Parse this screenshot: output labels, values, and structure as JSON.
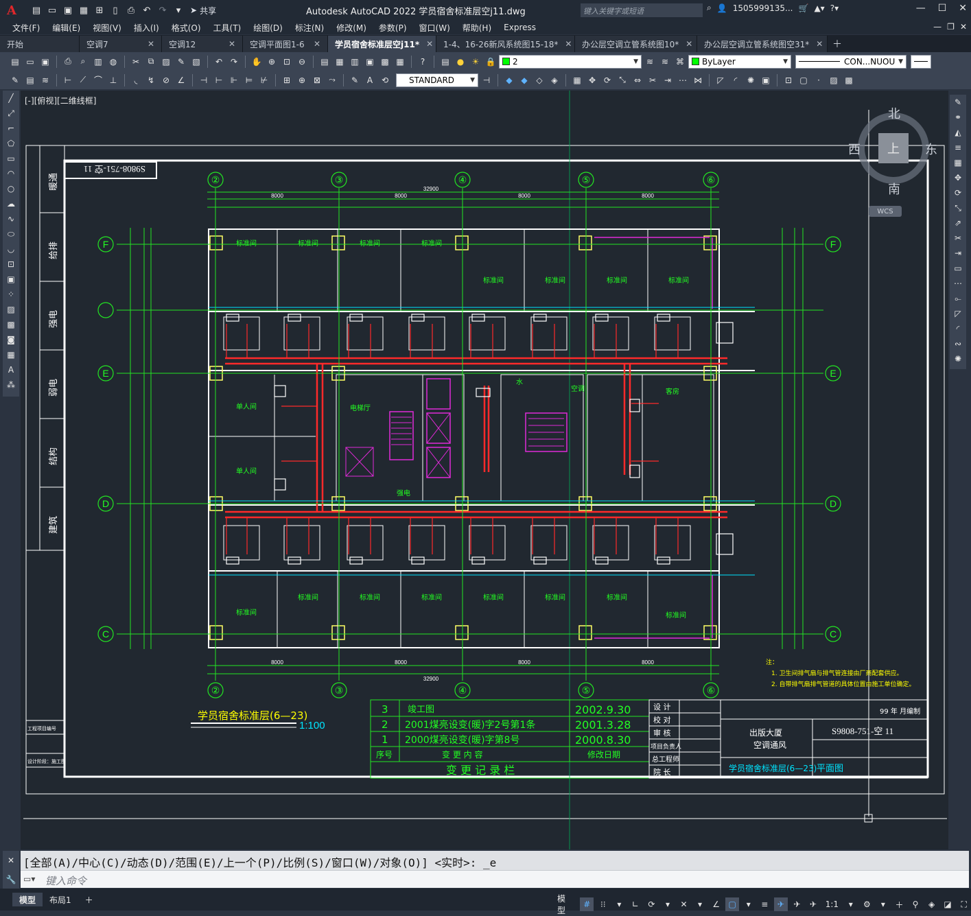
{
  "titlebar": {
    "app_icon": "A",
    "share_label": "共享",
    "title": "Autodesk AutoCAD 2022    学员宿舍标准层空j11.dwg",
    "search_placeholder": "键入关键字或短语",
    "user": "1505999135...",
    "icons": [
      "new-icon",
      "open-icon",
      "save-icon",
      "saveas-icon",
      "web-icon",
      "print-icon",
      "undo-icon",
      "redo-icon",
      "search-icon",
      "user-icon",
      "cart-icon",
      "autodesk-icon",
      "help-icon"
    ]
  },
  "menubar": {
    "items": [
      "文件(F)",
      "编辑(E)",
      "视图(V)",
      "插入(I)",
      "格式(O)",
      "工具(T)",
      "绘图(D)",
      "标注(N)",
      "修改(M)",
      "参数(P)",
      "窗口(W)",
      "帮助(H)",
      "Express"
    ]
  },
  "tabs": [
    {
      "label": "开始",
      "close": false,
      "active": false
    },
    {
      "label": "空调7",
      "close": true,
      "active": false
    },
    {
      "label": "空调12",
      "close": true,
      "active": false
    },
    {
      "label": "空调平面图1-6",
      "close": true,
      "active": false
    },
    {
      "label": "学员宿舍标准层空j11*",
      "close": true,
      "active": true
    },
    {
      "label": "1-4、16-26新风系统图15-18*",
      "close": true,
      "active": false
    },
    {
      "label": "办公层空调立管系统图10*",
      "close": true,
      "active": false
    },
    {
      "label": "办公层空调立管系统图空31*",
      "close": true,
      "active": false
    }
  ],
  "toolbar": {
    "layer_value": "2",
    "color_value": "ByLayer",
    "linetype_value": "CON...NUOU",
    "textstyle_value": "STANDARD"
  },
  "viewport": {
    "label": "[-][俯视][二维线框]",
    "viewcube": {
      "n": "北",
      "s": "南",
      "e": "东",
      "w": "西",
      "top": "上"
    },
    "wcs": "WCS"
  },
  "drawing": {
    "stamp": "S9808-751-空 11",
    "grid_cols": [
      "②",
      "③",
      "④",
      "⑤",
      "⑥"
    ],
    "grid_rows": [
      "F",
      "E",
      "D",
      "C"
    ],
    "dim_total": "32900",
    "dim_bays": [
      "8000",
      "8000",
      "8000",
      "8000"
    ],
    "rooms": {
      "std": "标准间",
      "single": "单人间",
      "elevator": "电梯厅",
      "water": "水",
      "ac": "空调",
      "guest": "客房",
      "strong": "强电"
    },
    "left_strip": [
      "暖通",
      "给排",
      "强电",
      "弱电",
      "结构",
      "建筑"
    ],
    "left_strip_low": [
      "工程项目编号",
      "设计阶段：施工图"
    ],
    "plan_title": "学员宿舍标准层(6—23)",
    "scale": "1:100",
    "notes_title": "注：",
    "notes": [
      "1. 卫生间排气扇与排气管连接由厂商配套供应。",
      "2. 自带排气扇排气管道的具体位置由施工单位确定。"
    ],
    "revisions": {
      "rows": [
        {
          "no": "3",
          "content": "竣工图",
          "date": "2002.9.30"
        },
        {
          "no": "2",
          "content": "2001煤亮设变(暖)字2号第1条",
          "date": "2001.3.28"
        },
        {
          "no": "1",
          "content": "2000煤亮设变(暖)字第8号",
          "date": "2000.8.30"
        }
      ],
      "head_no": "序号",
      "head_content": "变 更 内 容",
      "head_date": "修改日期",
      "caption": "变 更 记 录 栏"
    },
    "titleblock": {
      "roles": [
        "设 计",
        "校 对",
        "审 核",
        "项目负责人",
        "总工程师",
        "院 长"
      ],
      "year": "99 年   月编制",
      "project": "出版大厦",
      "system": "空调通风",
      "number": "S9808-751-空 11",
      "drawing_name": "学员宿舍标准层(6—23)",
      "drawing_type": "平面图"
    }
  },
  "command": {
    "history": "[全部(A)/中心(C)/动态(D)/范围(E)/上一个(P)/比例(S)/窗口(W)/对象(O)] <实时>: _e",
    "placeholder": "键入命令"
  },
  "status": {
    "tabs": [
      "模型",
      "布局1"
    ],
    "model_label": "模型",
    "scale": "1:1"
  },
  "colors": {
    "wall": "#ffffff",
    "duct": "#ff2a2a",
    "dim": "#22e622",
    "grid": "#00ff66",
    "text": "#22ff22",
    "cyan": "#00e5ff",
    "magenta": "#e02ad8",
    "yellow": "#ffff00"
  }
}
